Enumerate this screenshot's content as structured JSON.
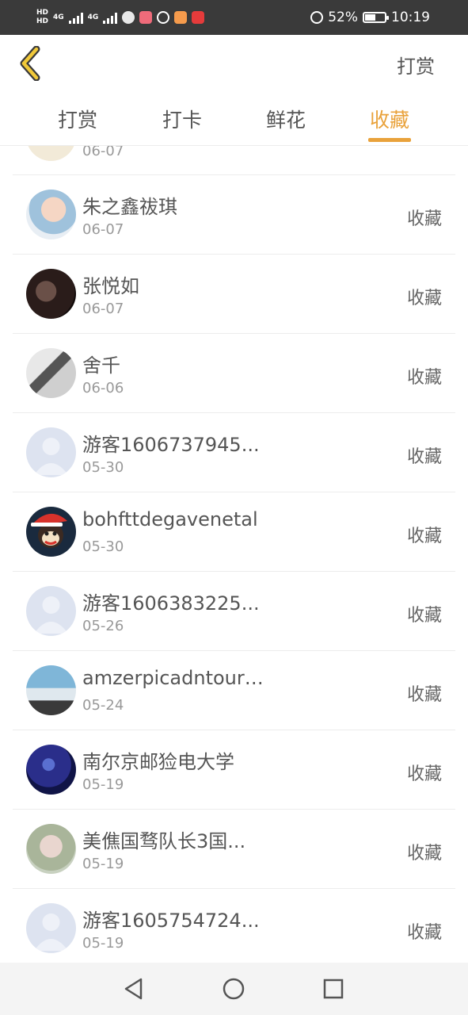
{
  "status_bar": {
    "sim1": "HD",
    "sim2": "HD",
    "network1": "4G",
    "network2": "4G",
    "battery_percent": "52%",
    "time": "10:19",
    "battery_level": 0.52
  },
  "header": {
    "action_label": "打赏"
  },
  "tabs": [
    {
      "label": "打赏",
      "active": false
    },
    {
      "label": "打卡",
      "active": false
    },
    {
      "label": "鲜花",
      "active": false
    },
    {
      "label": "收藏",
      "active": true
    }
  ],
  "list": [
    {
      "name": "",
      "date": "06-07",
      "badge": "",
      "partial": true
    },
    {
      "name": "朱之鑫祓琪",
      "date": "06-07",
      "badge": "收藏"
    },
    {
      "name": "张悦如",
      "date": "06-07",
      "badge": "收藏"
    },
    {
      "name": "舍千",
      "date": "06-06",
      "badge": "收藏"
    },
    {
      "name": "游客1606737945...",
      "date": "05-30",
      "badge": "收藏"
    },
    {
      "name": "bohfttdegavenetal",
      "date": "05-30",
      "badge": "收藏"
    },
    {
      "name": "游客1606383225...",
      "date": "05-26",
      "badge": "收藏"
    },
    {
      "name": "amzerpicadntouri...",
      "date": "05-24",
      "badge": "收藏"
    },
    {
      "name": "南尔京邮猃电大学",
      "date": "05-19",
      "badge": "收藏"
    },
    {
      "name": "美僬国骛队长3国...",
      "date": "05-19",
      "badge": "收藏"
    },
    {
      "name": "游客1605754724...",
      "date": "05-19",
      "badge": "收藏"
    }
  ],
  "colors": {
    "accent": "#e9a23b",
    "status_bar_bg": "#3a3a3a",
    "divider": "#ececec"
  },
  "icons": {
    "back": "chevron-left-icon",
    "nav_back": "triangle-back-icon",
    "nav_home": "circle-home-icon",
    "nav_recent": "square-recent-icon"
  }
}
